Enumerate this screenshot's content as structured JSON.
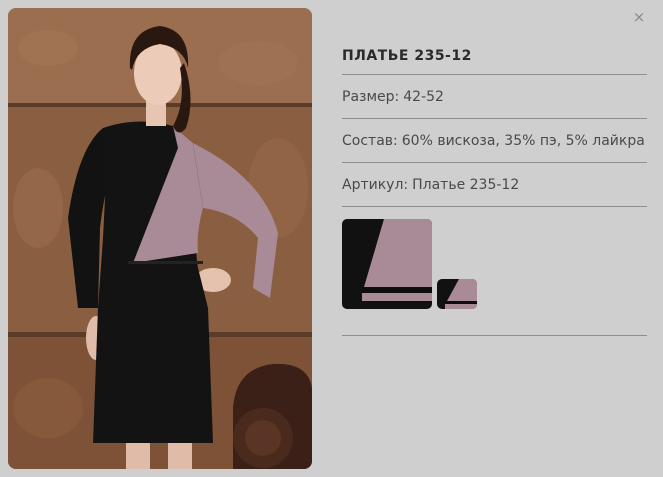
{
  "close": {
    "glyph": "×"
  },
  "product": {
    "title": "ПЛАТЬЕ 235-12",
    "size_label": "Размер:",
    "size_value": "42-52",
    "composition_label": "Состав:",
    "composition_value": "60% вискоза, 35% пэ, 5% лайкра",
    "article_label": "Артикул:",
    "article_value": "Платье 235-12"
  },
  "colors": {
    "background": "#cfcfcf",
    "dress_black": "#111111",
    "dress_mauve": "#a98a97",
    "wall": "#8a5c3e",
    "divider": "#8e8e8e"
  }
}
